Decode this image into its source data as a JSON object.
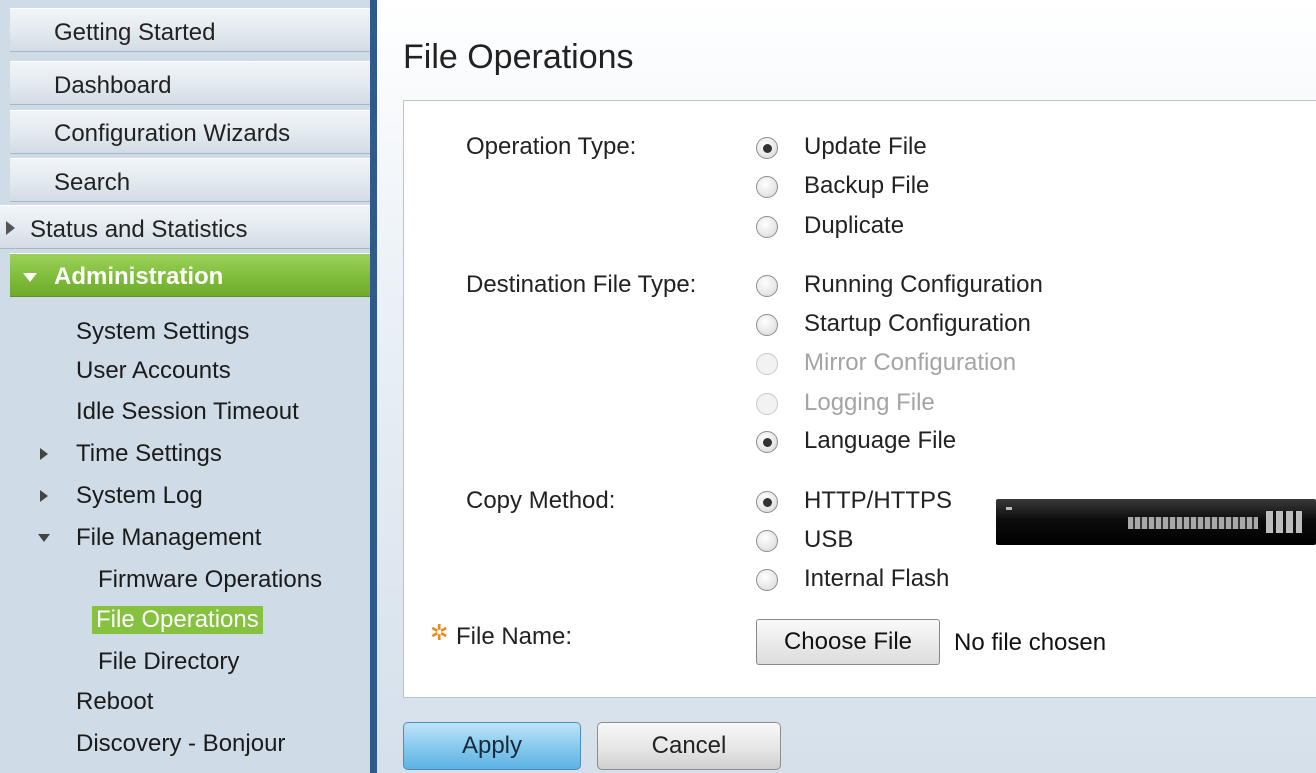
{
  "sidebar": {
    "top_items": [
      {
        "label": "Getting Started"
      },
      {
        "label": "Dashboard"
      },
      {
        "label": "Configuration Wizards"
      },
      {
        "label": "Search"
      },
      {
        "label": "Status and Statistics"
      },
      {
        "label": "Administration"
      }
    ],
    "admin_items": {
      "system_settings": "System Settings",
      "user_accounts": "User Accounts",
      "idle_session_timeout": "Idle Session Timeout",
      "time_settings": "Time Settings",
      "system_log": "System Log",
      "file_management": "File Management",
      "firmware_operations": "Firmware Operations",
      "file_operations": "File Operations",
      "file_directory": "File Directory",
      "reboot": "Reboot",
      "discovery_bonjour": "Discovery - Bonjour"
    },
    "active_color": "#80bd3b"
  },
  "page": {
    "title": "File Operations"
  },
  "form": {
    "operation_type": {
      "label": "Operation Type:",
      "options": [
        "Update File",
        "Backup File",
        "Duplicate"
      ],
      "selected": "Update File"
    },
    "destination_file_type": {
      "label": "Destination File Type:",
      "options": [
        "Running Configuration",
        "Startup Configuration",
        "Mirror Configuration",
        "Logging File",
        "Language File"
      ],
      "disabled": [
        "Mirror Configuration",
        "Logging File"
      ],
      "selected": "Language File"
    },
    "copy_method": {
      "label": "Copy Method:",
      "options": [
        "HTTP/HTTPS",
        "USB",
        "Internal Flash"
      ],
      "selected": "HTTP/HTTPS"
    },
    "file_name": {
      "label": "File Name:",
      "required_icon": "required-star-icon",
      "choose_button": "Choose File",
      "status": "No file chosen"
    }
  },
  "actions": {
    "apply": "Apply",
    "cancel": "Cancel"
  }
}
